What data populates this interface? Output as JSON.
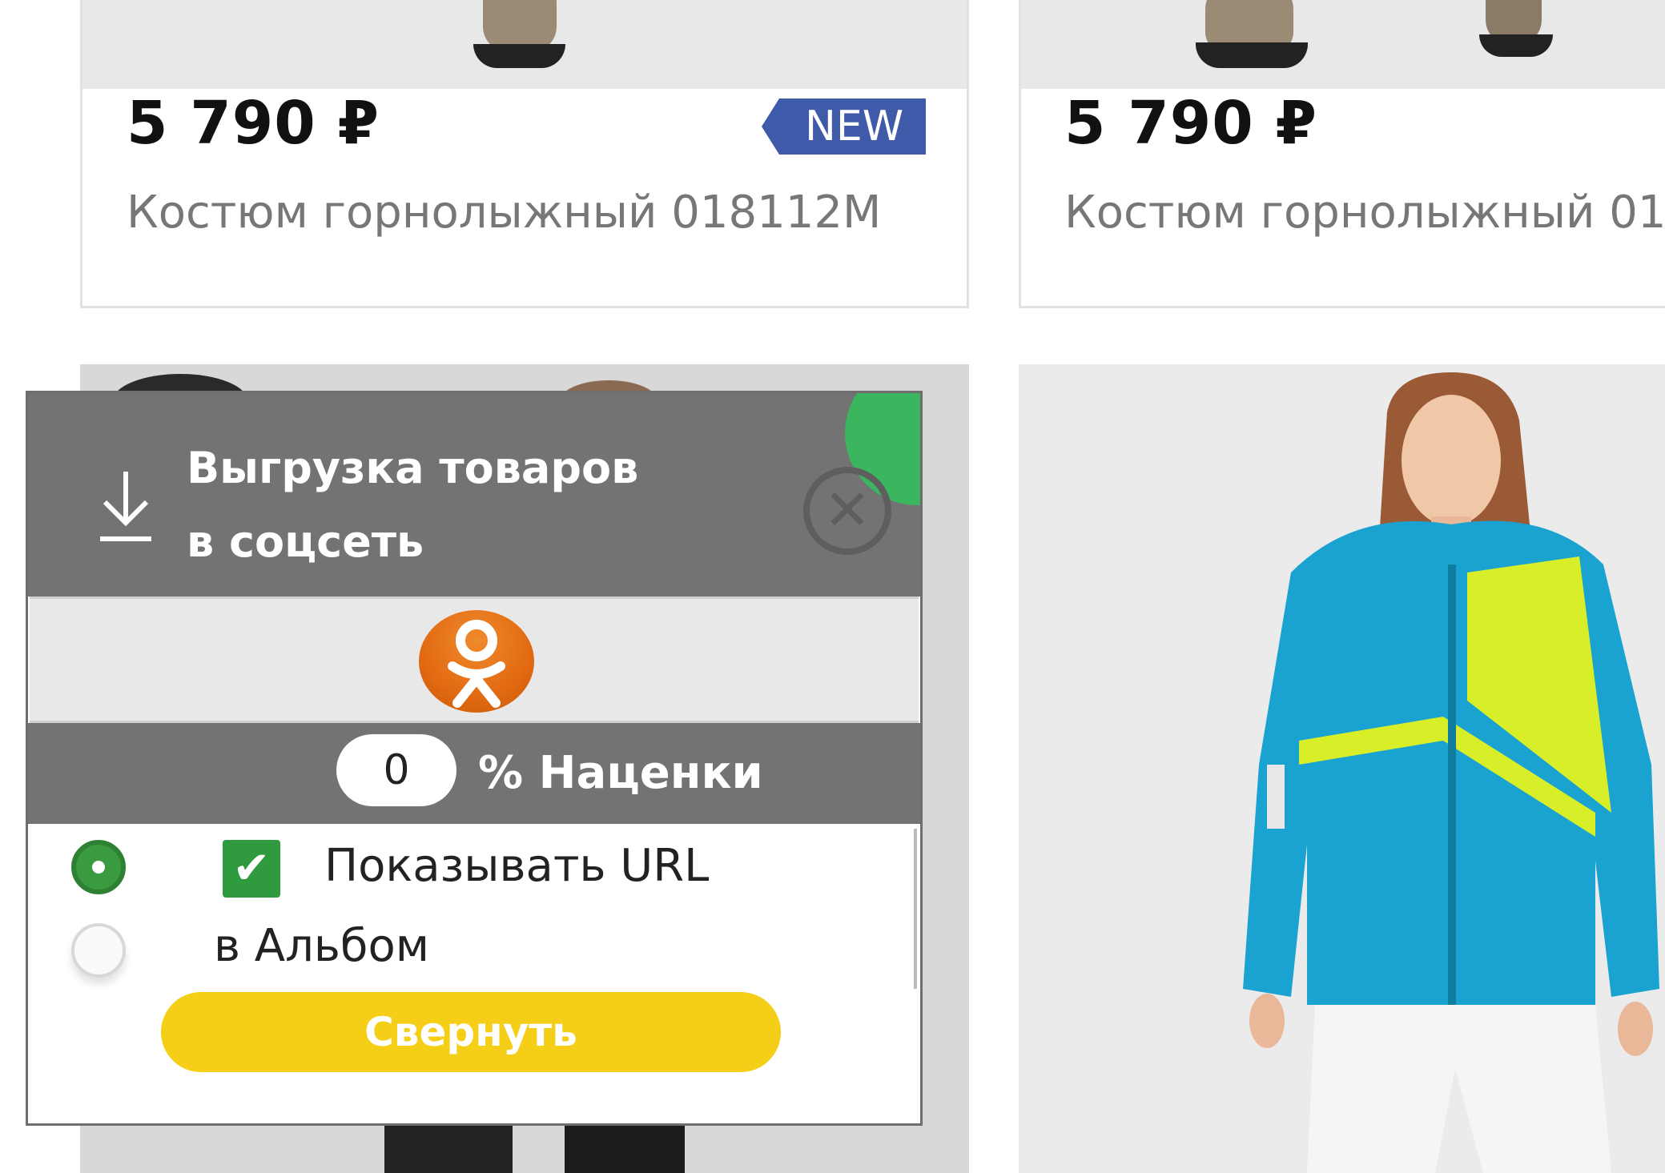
{
  "products": [
    {
      "price": "5 790 ₽",
      "title": "Костюм горнолыжный 018112M",
      "badge": "NEW"
    },
    {
      "price": "5 790 ₽",
      "title": "Костюм горнолыжный 01"
    }
  ],
  "widget": {
    "title_line1": "Выгрузка товаров",
    "title_line2": "в соцсеть",
    "icons": {
      "download": "download-icon",
      "close": "close-icon",
      "social": "odnoklassniki-icon"
    },
    "markup_value": "0",
    "markup_label": "% Наценки",
    "options": {
      "show_url": {
        "label": "Показывать URL",
        "checked": true
      },
      "album": {
        "label": "в Альбом",
        "checked": false
      }
    },
    "collapse_label": "Свернуть",
    "colors": {
      "header": "#737373",
      "accent_green": "#3bb55e",
      "button_yellow": "#f4ce17",
      "badge_blue": "#3e5aa8",
      "ok_orange": "#ee8208"
    }
  }
}
